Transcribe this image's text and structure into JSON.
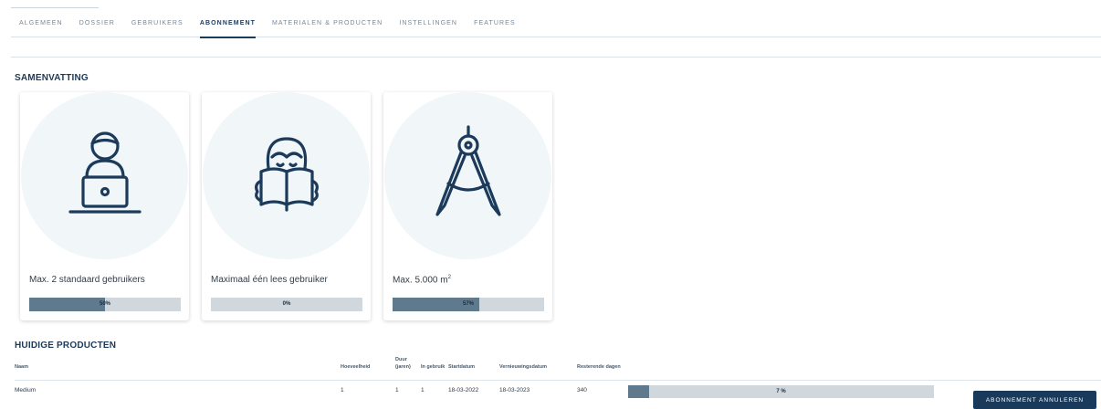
{
  "tabs": [
    {
      "label": "ALGEMEEN",
      "active": false
    },
    {
      "label": "DOSSIER",
      "active": false
    },
    {
      "label": "GEBRUIKERS",
      "active": false
    },
    {
      "label": "ABONNEMENT",
      "active": true
    },
    {
      "label": "MATERIALEN & PRODUCTEN",
      "active": false
    },
    {
      "label": "INSTELLINGEN",
      "active": false
    },
    {
      "label": "FEATURES",
      "active": false
    }
  ],
  "summary": {
    "title": "SAMENVATTING",
    "cards": [
      {
        "icon": "user-laptop-icon",
        "label": "Max. 2 standaard gebruikers",
        "percent": 50,
        "percent_label": "50%"
      },
      {
        "icon": "reading-person-icon",
        "label": "Maximaal één lees gebruiker",
        "percent": 0,
        "percent_label": "0%"
      },
      {
        "icon": "compass-icon",
        "label": "Max. 5.000 m",
        "label_sup": "2",
        "percent": 57,
        "percent_label": "57%"
      }
    ]
  },
  "products": {
    "title": "HUIDIGE PRODUCTEN",
    "columns": {
      "name": "Naam",
      "quantity": "Hoeveelheid",
      "duration": "Duur (jaren)",
      "in_use": "In gebruik",
      "start": "Startdatum",
      "renewal": "Vernieuwingsdatum",
      "remaining": "Resterende dagen"
    },
    "rows": [
      {
        "name": "Medium",
        "quantity": "1",
        "duration": "1",
        "in_use": "1",
        "start": "18-03-2022",
        "renewal": "18-03-2023",
        "remaining": "340",
        "percent": 7,
        "percent_label": "7 %"
      }
    ],
    "cancel_label": "ABONNEMENT ANNULEREN"
  },
  "colors": {
    "primary": "#1a3a5c",
    "bar_fill": "#5f7a8d",
    "bar_track": "#d0d8de",
    "icon_bg": "#f1f6f9"
  }
}
